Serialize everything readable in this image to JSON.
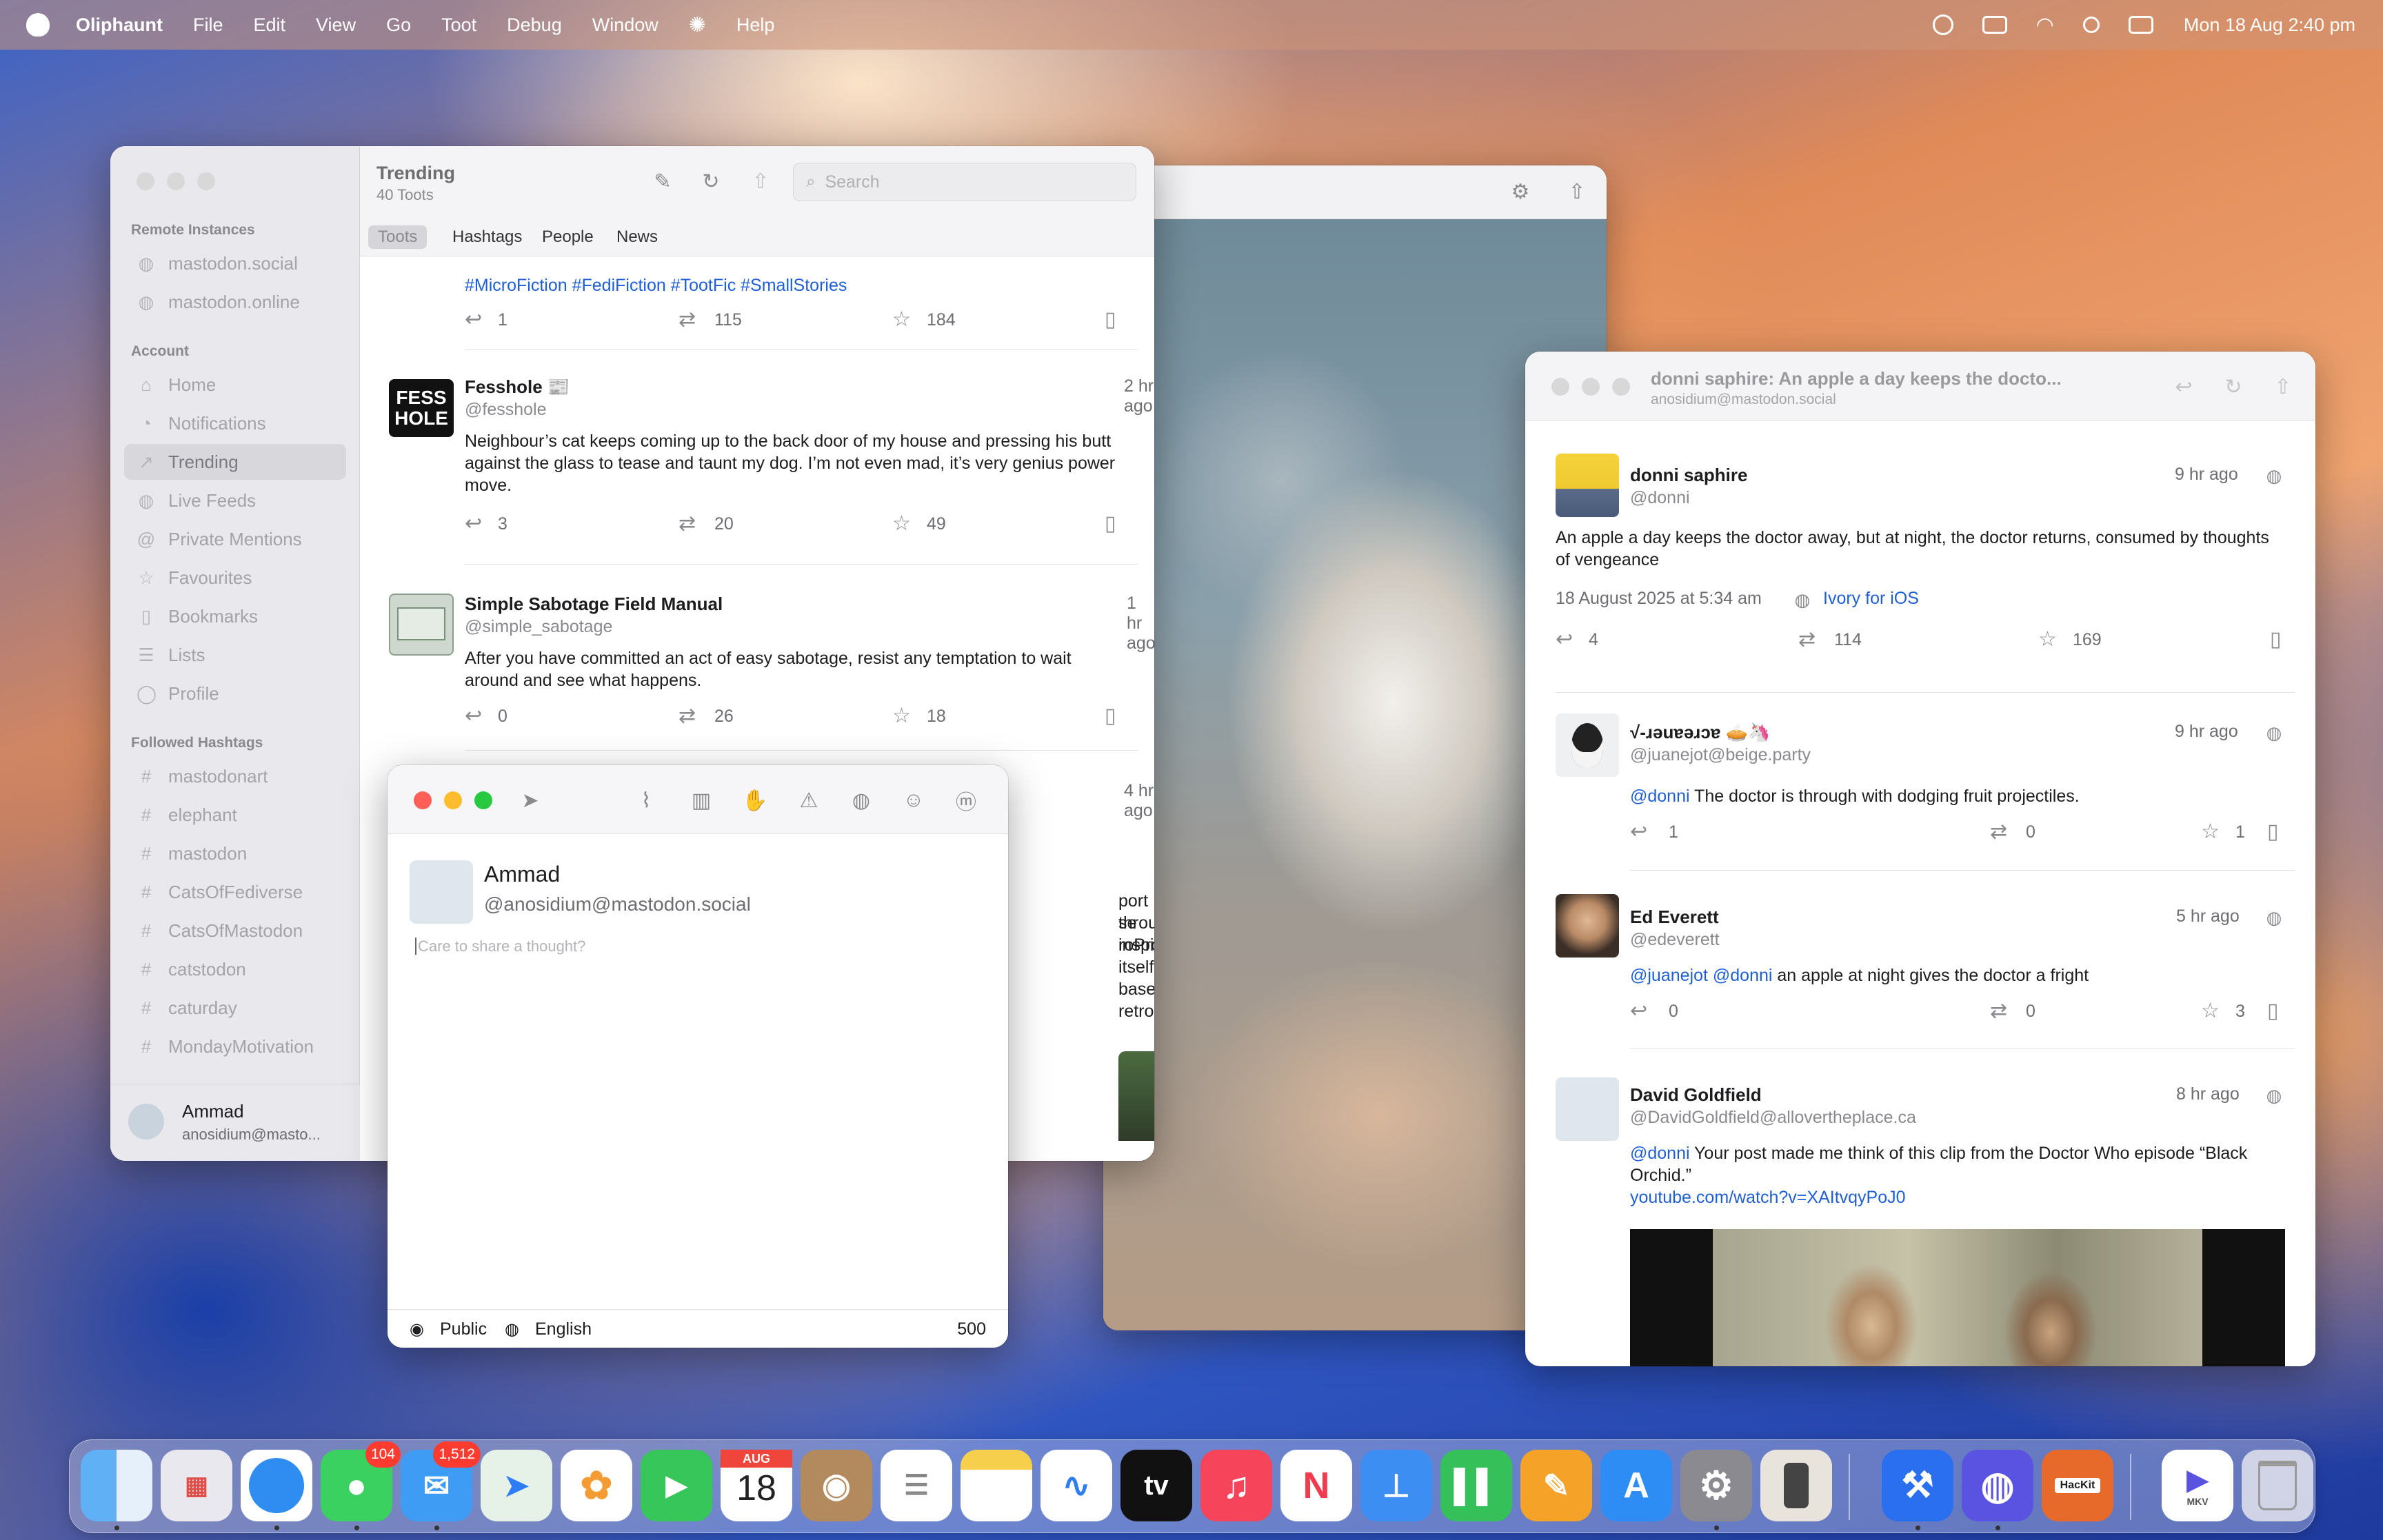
{
  "menubar": {
    "app": "Oliphaunt",
    "items": [
      "File",
      "Edit",
      "View",
      "Go",
      "Toot",
      "Debug",
      "Window",
      "Help"
    ],
    "clock": "Mon 18 Aug  2:40 pm"
  },
  "main": {
    "title": "Trending",
    "subtitle": "40 Toots",
    "search_placeholder": "Search",
    "tabs": [
      "Toots",
      "Hashtags",
      "People",
      "News"
    ],
    "sidebar": {
      "remote_heading": "Remote Instances",
      "remote": [
        "mastodon.social",
        "mastodon.online"
      ],
      "account_heading": "Account",
      "account": [
        "Home",
        "Notifications",
        "Trending",
        "Live Feeds",
        "Private Mentions",
        "Favourites",
        "Bookmarks",
        "Lists",
        "Profile"
      ],
      "hashtags_heading": "Followed Hashtags",
      "hashtags": [
        "mastodonart",
        "elephant",
        "mastodon",
        "CatsOfFediverse",
        "CatsOfMastodon",
        "catstodon",
        "caturday",
        "MondayMotivation"
      ],
      "user_name": "Ammad",
      "user_handle": "anosidium@masto..."
    },
    "posts": [
      {
        "text": "#MicroFiction #FediFiction #TootFic #SmallStories",
        "replies": "1",
        "boosts": "115",
        "favs": "184"
      },
      {
        "name": "Fesshole 📰",
        "handle": "@fesshole",
        "time": "2 hr ago",
        "avatar_text": "FESS HOLE",
        "text": "Neighbour’s cat keeps coming up to the back door of my house and pressing his butt against the glass to tease and taunt my dog. I’m not even mad, it’s very genius power move.",
        "replies": "3",
        "boosts": "20",
        "favs": "49"
      },
      {
        "name": "Simple Sabotage Field Manual",
        "handle": "@simple_sabotage",
        "time": "1 hr ago",
        "text": "After you have committed an act of easy sabotage, resist any temptation to wait around and see what happens.",
        "replies": "0",
        "boosts": "26",
        "favs": "18"
      },
      {
        "time": "4 hr ago",
        "fragments": [
          "port through",
          "se inspired",
          "roProse itself!",
          "based retro"
        ]
      }
    ]
  },
  "compose": {
    "name": "Ammad",
    "handle": "@anosidium@mastodon.social",
    "placeholder": "Care to share a thought?",
    "visibility": "Public",
    "language": "English",
    "count": "500"
  },
  "thread": {
    "title": "donni saphire: An apple a day keeps the docto...",
    "subtitle": "anosidium@mastodon.social",
    "main": {
      "name": "donni saphire",
      "handle": "@donni",
      "time": "9 hr ago",
      "text": "An apple a day keeps the doctor away, but at night, the doctor returns, consumed by thoughts of vengeance",
      "date": "18 August 2025 at 5:34 am",
      "client": "Ivory for iOS",
      "replies": "4",
      "boosts": "114",
      "favs": "169"
    },
    "replies": [
      {
        "name": "√-ɹǝuɐǝɹɔɐ 🥧🦄",
        "handle": "@juanejot@beige.party",
        "time": "9 hr ago",
        "mention": "@donni",
        "text": " The doctor is through with dodging fruit projectiles.",
        "replies": "1",
        "boosts": "0",
        "favs": "1"
      },
      {
        "name": "Ed Everett",
        "handle": "@edeverett",
        "time": "5 hr ago",
        "mention": "@juanejot @donni",
        "text": " an apple at night gives the doctor a fright",
        "replies": "0",
        "boosts": "0",
        "favs": "3"
      },
      {
        "name": "David Goldfield",
        "handle": "@DavidGoldfield@allovertheplace.ca",
        "time": "8 hr ago",
        "mention": "@donni",
        "text": " Your post made me think of this clip from the Doctor Who episode “Black Orchid.”",
        "link": "youtube.com/watch?v=XAItvqyPoJ0"
      }
    ]
  },
  "dock": {
    "messages_badge": "104",
    "mail_badge": "1,512",
    "calendar_month": "AUG",
    "calendar_day": "18",
    "tv_label": "tv",
    "hackit_label": "HacKit",
    "mkv_label": "MKV"
  }
}
